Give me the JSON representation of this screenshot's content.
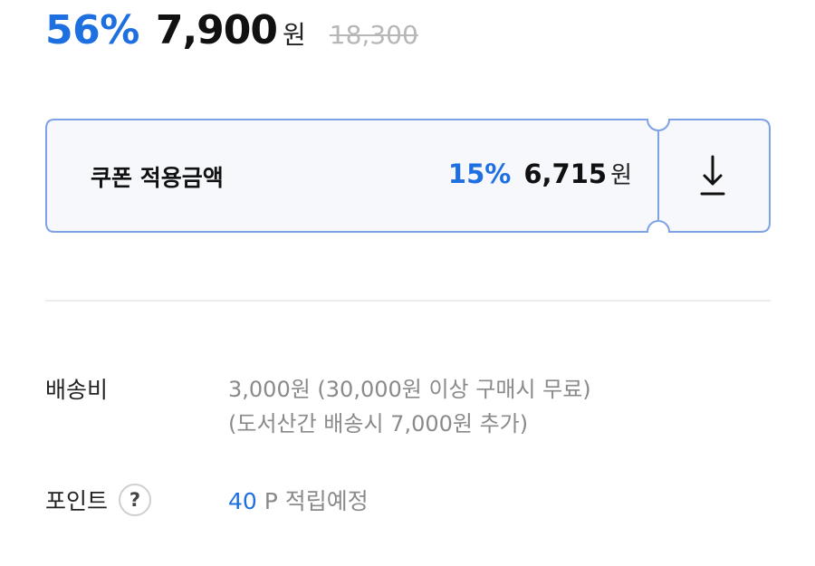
{
  "price": {
    "discount_rate": "56%",
    "sale_price": "7,900",
    "currency": "원",
    "original_price": "18,300"
  },
  "coupon": {
    "label": "쿠폰 적용금액",
    "rate": "15%",
    "price": "6,715",
    "currency": "원",
    "download_icon": "download-arrow-icon"
  },
  "shipping": {
    "label": "배송비",
    "line1": "3,000원 (30,000원 이상 구매시 무료)",
    "line2": "(도서산간 배송시 7,000원 추가)"
  },
  "points": {
    "label": "포인트",
    "help_symbol": "?",
    "amount": "40",
    "unit_text": " P 적립예정"
  },
  "colors": {
    "accent": "#1e6fe0",
    "coupon_border": "#7ea2e6",
    "coupon_bg": "#f6f8fc"
  }
}
